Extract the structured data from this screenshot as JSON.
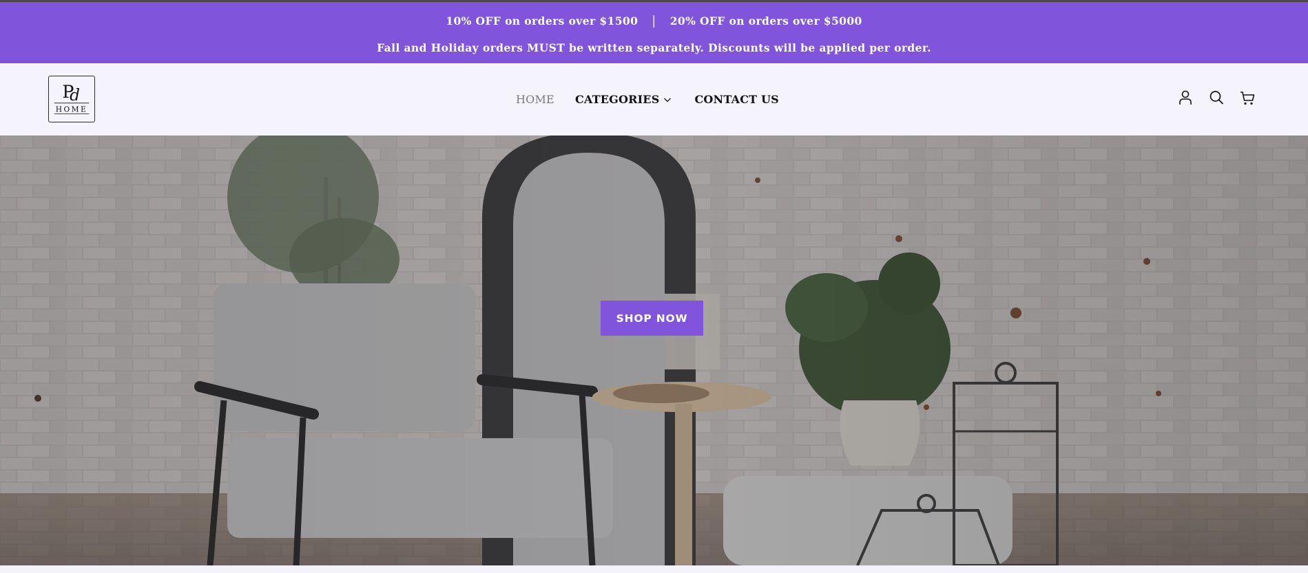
{
  "announcement": {
    "offer_1": "10% OFF on orders over $1500",
    "separator": "|",
    "offer_2": "20% OFF on orders over $5000",
    "notice": "Fall and Holiday orders MUST be written separately. Discounts will be applied per order.",
    "background_color": "#8155db"
  },
  "header": {
    "logo": {
      "monogram": "Pd",
      "wordmark": "HOME"
    },
    "nav": {
      "home": "HOME",
      "categories": "CATEGORIES",
      "contact": "CONTACT US"
    },
    "icons": [
      "account-icon",
      "search-icon",
      "cart-icon"
    ]
  },
  "hero": {
    "button_label": "SHOP NOW",
    "button_color": "#8155db"
  }
}
